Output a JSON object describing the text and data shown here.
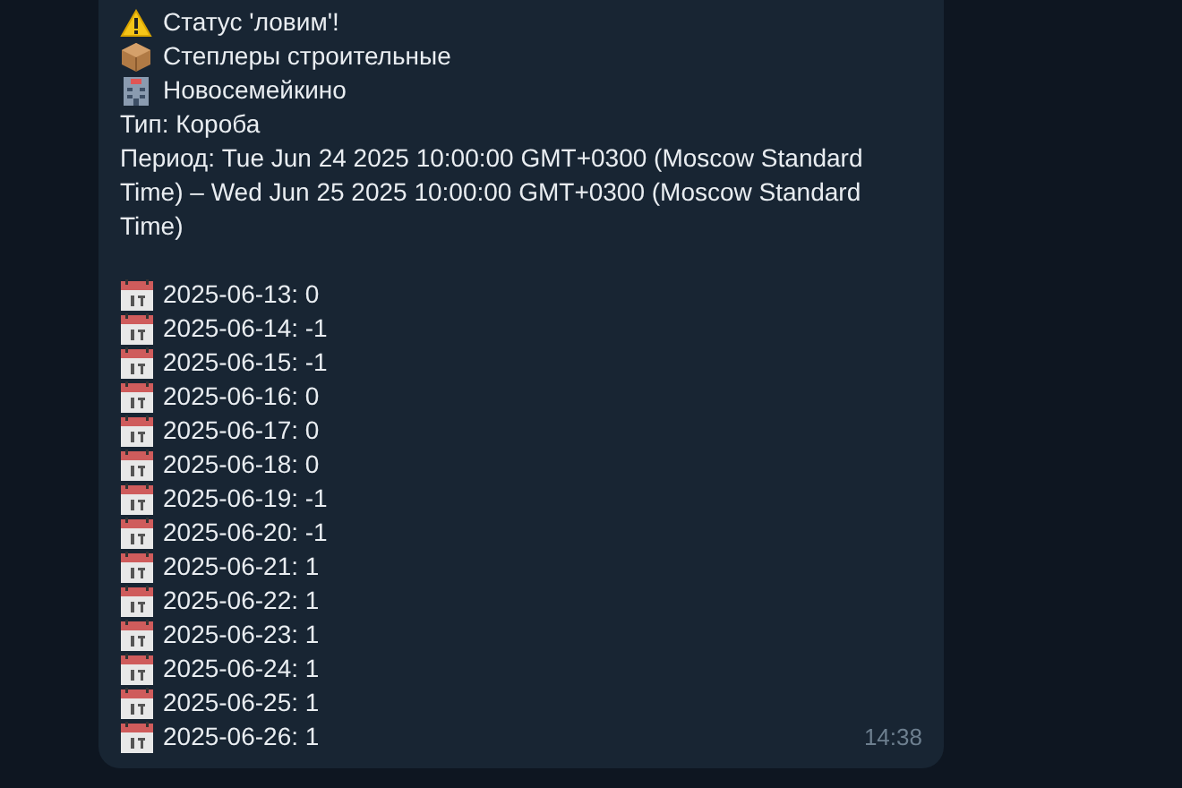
{
  "message": {
    "header_lines": [
      {
        "kind": "warning",
        "text": "Статус 'ловим'!"
      },
      {
        "kind": "package",
        "text": "Степлеры строительные"
      },
      {
        "kind": "building",
        "text": "Новосемейкино"
      }
    ],
    "details": [
      "Тип: Короба",
      "Период: Tue Jun 24 2025 10:00:00 GMT+0300 (Moscow Standard Time) – Wed Jun 25 2025 10:00:00 GMT+0300 (Moscow Standard Time)"
    ],
    "daily_counts": [
      "2025-06-13: 0",
      "2025-06-14: -1",
      "2025-06-15: -1",
      "2025-06-16: 0",
      "2025-06-17: 0",
      "2025-06-18: 0",
      "2025-06-19: -1",
      "2025-06-20: -1",
      "2025-06-21: 1",
      "2025-06-22: 1",
      "2025-06-23: 1",
      "2025-06-24: 1",
      "2025-06-25: 1",
      "2025-06-26: 1"
    ],
    "time": "14:38"
  }
}
